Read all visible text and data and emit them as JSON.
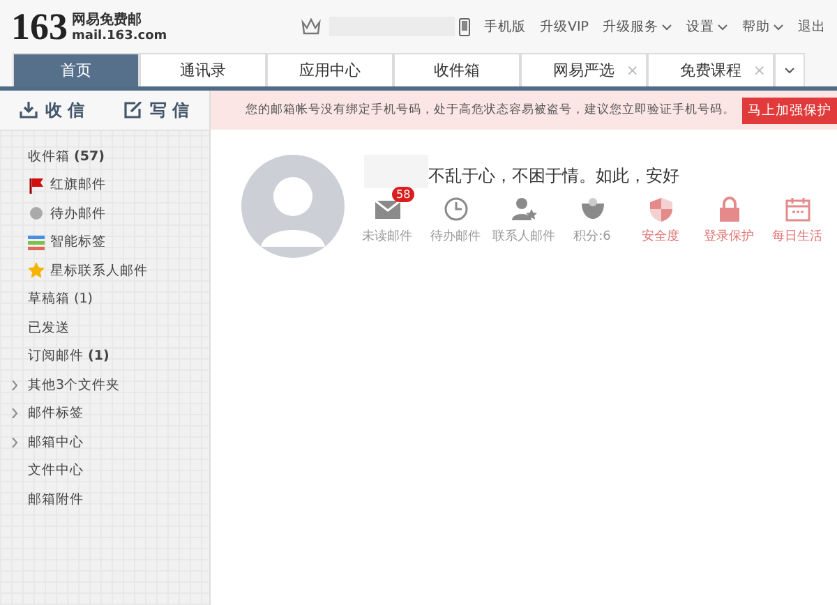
{
  "logo": {
    "number": "163",
    "name": "网易免费邮",
    "domain": "mail.163.com"
  },
  "top_links": [
    {
      "label": "手机版",
      "dropdown": false
    },
    {
      "label": "升级VIP",
      "dropdown": false
    },
    {
      "label": "升级服务",
      "dropdown": true
    },
    {
      "label": "设置",
      "dropdown": true
    },
    {
      "label": "帮助",
      "dropdown": true
    },
    {
      "label": "退出",
      "dropdown": false
    }
  ],
  "tabs": [
    {
      "label": "首页",
      "selected": true
    },
    {
      "label": "通讯录",
      "selected": false
    },
    {
      "label": "应用中心",
      "selected": false
    },
    {
      "label": "收件箱",
      "selected": false
    },
    {
      "label": "网易严选",
      "selected": false,
      "close": "×"
    },
    {
      "label": "免费课程",
      "selected": false,
      "close": "×"
    }
  ],
  "receive_button": "收 信",
  "compose_button": "写 信",
  "alert": {
    "text": "您的邮箱帐号没有绑定手机号码，处于高危状态容易被盗号，建议您立即验证手机号码。",
    "action": "马上加强保护"
  },
  "sidebar": [
    {
      "label": "收件箱 **(57)**",
      "kind": "plain"
    },
    {
      "label": "红旗邮件",
      "kind": "flag"
    },
    {
      "label": "待办邮件",
      "kind": "dot"
    },
    {
      "label": "智能标签",
      "kind": "tags"
    },
    {
      "label": "星标联系人邮件",
      "kind": "star"
    },
    {
      "label": "草稿箱 (1)",
      "kind": "plain"
    },
    {
      "label": "已发送",
      "kind": "plain"
    },
    {
      "label": "订阅邮件 **(1)**",
      "kind": "plain"
    },
    {
      "label": "其他3个文件夹",
      "kind": "plain",
      "expanded": false
    },
    {
      "label": "邮件标签",
      "kind": "plain",
      "expanded": false
    },
    {
      "label": "邮箱中心",
      "kind": "plain",
      "expanded": false
    },
    {
      "label": "文件中心",
      "kind": "plain"
    },
    {
      "label": "邮箱附件",
      "kind": "plain"
    }
  ],
  "motto": "不乱于心，不困于情。如此，安好",
  "shortcuts": [
    {
      "label": "未读邮件",
      "kind": "mail",
      "badge": "58",
      "warn": false
    },
    {
      "label": "待办邮件",
      "kind": "clock",
      "warn": false
    },
    {
      "label": "联系人邮件",
      "kind": "contact",
      "warn": false
    },
    {
      "label": "积分:6",
      "kind": "points",
      "warn": false
    },
    {
      "label": "安全度",
      "kind": "shield",
      "warn": true
    },
    {
      "label": "登录保护",
      "kind": "lock",
      "warn": true
    },
    {
      "label": "每日生活",
      "kind": "calendar",
      "warn": true
    }
  ]
}
